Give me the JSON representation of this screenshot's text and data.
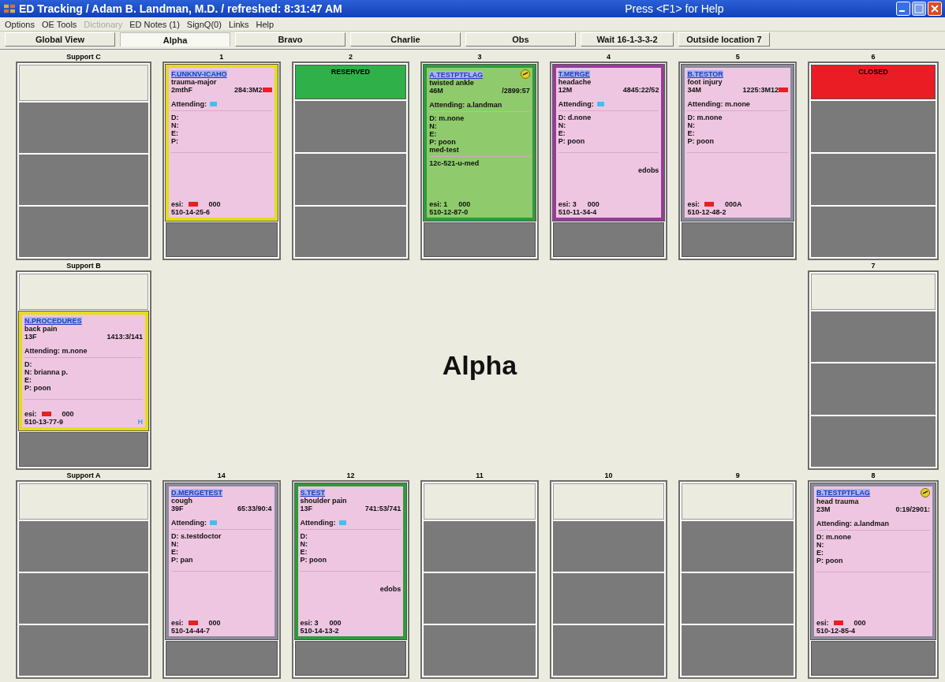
{
  "window": {
    "title": "ED Tracking / Adam B. Landman, M.D. / refreshed: 8:31:47 AM",
    "help": "Press <F1> for Help"
  },
  "menu": [
    {
      "label": "Options",
      "disabled": false
    },
    {
      "label": "OE Tools",
      "disabled": false
    },
    {
      "label": "Dictionary",
      "disabled": true
    },
    {
      "label": "ED Notes (1)",
      "disabled": false
    },
    {
      "label": "SignQ(0)",
      "disabled": false
    },
    {
      "label": "Links",
      "disabled": false
    },
    {
      "label": "Help",
      "disabled": false
    }
  ],
  "tabs": [
    {
      "label": "Global View",
      "selected": false
    },
    {
      "label": "Alpha",
      "selected": true
    },
    {
      "label": "Bravo",
      "selected": false
    },
    {
      "label": "Charlie",
      "selected": false
    },
    {
      "label": "Obs",
      "selected": false
    },
    {
      "label": "Wait 16-1-3-3-2",
      "selected": false
    },
    {
      "label": "Outside location  7",
      "selected": false
    }
  ],
  "area_title": "Alpha",
  "left": [
    {
      "label": "Support C",
      "kind": "empty"
    },
    {
      "label": "Support B",
      "kind": "patient",
      "empty_header": true,
      "color": "#e4dc1c",
      "highlighted": false,
      "name": "N.PROCEDURES",
      "complaint": "back pain",
      "age": "13F",
      "times": "1413:3/141",
      "times_flag": false,
      "attending": "Attending: m.none",
      "attending_flag": false,
      "staff": [
        "D:",
        "N: brianna p.",
        "E:",
        "P: poon"
      ],
      "esi": "esi:",
      "esi_flag": true,
      "esi_code": "000",
      "mrn": "510-13-77-9",
      "flag_icon": false,
      "badge": "H"
    },
    {
      "label": "Support A",
      "kind": "empty"
    }
  ],
  "center_top": [
    {
      "label": "1",
      "kind": "patient",
      "empty_header": false,
      "color": "#e4dc1c",
      "highlighted": false,
      "name": "F.UNKNV-ICAHO",
      "complaint": "trauma-major",
      "age": "2mthF",
      "times": "284:3M2",
      "times_flag": true,
      "attending": "Attending:",
      "attending_flag": true,
      "staff": [
        "D:",
        "N:",
        "E:",
        "P:"
      ],
      "esi": "esi:",
      "esi_flag": true,
      "esi_code": "000",
      "mrn": "510-14-25-6",
      "flag_icon": false
    },
    {
      "label": "2",
      "kind": "reserved",
      "text": "RESERVED"
    },
    {
      "label": "3",
      "kind": "patient",
      "empty_header": false,
      "color": "#2f9a3c",
      "highlighted": true,
      "name": "A.TESTPTFLAG",
      "complaint": "twisted ankle",
      "age": "46M",
      "times": "/2899:57",
      "times_flag": false,
      "attending": "Attending: a.landman",
      "attending_flag": false,
      "staff": [
        "D: m.none",
        "N:",
        "E:",
        "P: poon",
        "med-test"
      ],
      "notes": [
        "12c-521-u-med"
      ],
      "esi": "esi: 1",
      "esi_flag": false,
      "esi_code": "000",
      "mrn": "510-12-87-0",
      "flag_icon": true
    },
    {
      "label": "4",
      "kind": "patient",
      "empty_header": false,
      "color": "#983c98",
      "highlighted": false,
      "name": "T.MERGE",
      "complaint": "headache",
      "age": "12M",
      "times": "4845:22/52",
      "times_flag": false,
      "attending": "Attending:",
      "attending_flag": true,
      "staff": [
        "D: d.none",
        "N:",
        "E:",
        "P: poon"
      ],
      "right_note": "edobs",
      "esi": "esi: 3",
      "esi_flag": false,
      "esi_code": "000",
      "mrn": "510-11-34-4",
      "flag_icon": false
    },
    {
      "label": "5",
      "kind": "patient",
      "empty_header": false,
      "color": "#8a8a9a",
      "highlighted": false,
      "name": "B.TESTOR",
      "complaint": "foot injury",
      "age": "34M",
      "times": "1225:3M12",
      "times_flag": true,
      "attending": "Attending: m.none",
      "attending_flag": false,
      "staff": [
        "D: m.none",
        "N:",
        "E:",
        "P: poon"
      ],
      "esi": "esi:",
      "esi_flag": true,
      "esi_code": "000A",
      "mrn": "510-12-48-2",
      "flag_icon": false
    }
  ],
  "center_bottom": [
    {
      "label": "14",
      "kind": "patient",
      "empty_header": false,
      "color": "#8a8a9a",
      "highlighted": false,
      "name": "D.MERGETEST",
      "complaint": "cough",
      "age": "39F",
      "times": "65:33/90:4",
      "times_flag": false,
      "attending": "Attending:",
      "attending_flag": true,
      "staff": [
        "D: s.testdoctor",
        "N:",
        "E:",
        "P: pan"
      ],
      "esi": "esi:",
      "esi_flag": true,
      "esi_code": "000",
      "mrn": "510-14-44-7",
      "flag_icon": false
    },
    {
      "label": "12",
      "kind": "patient",
      "empty_header": false,
      "color": "#2f9a3c",
      "highlighted": false,
      "name": "S.TEST",
      "complaint": "shoulder pain",
      "age": "13F",
      "times": "741:53/741",
      "times_flag": false,
      "attending": "Attending:",
      "attending_flag": true,
      "staff": [
        "D:",
        "N:",
        "E:",
        "P: poon"
      ],
      "right_note": "edobs",
      "esi": "esi: 3",
      "esi_flag": false,
      "esi_code": "000",
      "mrn": "510-14-13-2",
      "flag_icon": false
    },
    {
      "label": "11",
      "kind": "empty"
    },
    {
      "label": "10",
      "kind": "empty"
    },
    {
      "label": "9",
      "kind": "empty"
    }
  ],
  "right": [
    {
      "label": "6",
      "kind": "closed",
      "text": "CLOSED"
    },
    {
      "label": "7",
      "kind": "empty"
    },
    {
      "label": "8",
      "kind": "patient",
      "empty_header": false,
      "color": "#8a8a9a",
      "highlighted": false,
      "name": "B.TESTPTFLAG",
      "complaint": "head trauma",
      "age": "23M",
      "times": "0:19/2901:",
      "times_flag": false,
      "attending": "Attending: a.landman",
      "attending_flag": false,
      "staff": [
        "D: m.none",
        "N:",
        "E:",
        "P: poon"
      ],
      "esi": "esi:",
      "esi_flag": true,
      "esi_code": "000",
      "mrn": "510-12-85-4",
      "flag_icon": true
    }
  ]
}
